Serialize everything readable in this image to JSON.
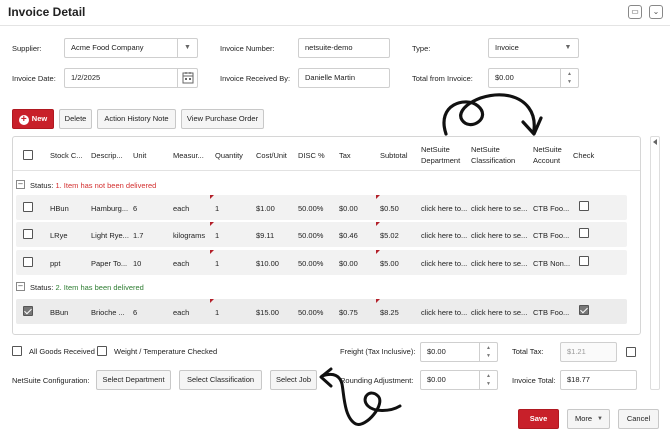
{
  "window": {
    "title": "Invoice Detail"
  },
  "form": {
    "supplier_label": "Supplier:",
    "supplier_value": "Acme Food Company",
    "invoice_number_label": "Invoice Number:",
    "invoice_number_value": "netsuite-demo",
    "type_label": "Type:",
    "type_value": "Invoice",
    "invoice_date_label": "Invoice Date:",
    "invoice_date_value": "1/2/2025",
    "received_by_label": "Invoice Received By:",
    "received_by_value": "Danielle Martin",
    "total_from_invoice_label": "Total from Invoice:",
    "total_from_invoice_value": "$0.00"
  },
  "toolbar": {
    "new_label": "New",
    "delete_label": "Delete",
    "history_label": "Action History Note",
    "view_po_label": "View Purchase Order"
  },
  "table": {
    "headers": {
      "stock_code": "Stock C...",
      "description": "Descrip...",
      "unit": "Unit",
      "measure": "Measur...",
      "quantity": "Quantity",
      "cost_unit": "Cost/Unit",
      "disc": "DISC %",
      "tax": "Tax",
      "subtotal": "Subtotal",
      "ns_department": "NetSuite\nDepartment",
      "ns_classification": "NetSuite\nClassification",
      "ns_account": "NetSuite\nAccount",
      "check": "Check"
    },
    "groups": [
      {
        "status_prefix": "Status: ",
        "status_text": "1. Item has not been delivered",
        "status_color": "#d32f2f",
        "rows": [
          {
            "code": "HBun",
            "desc": "Hamburg...",
            "unit": "6",
            "measure": "each",
            "qty": "1",
            "cost": "$1.00",
            "disc": "50.00%",
            "tax": "$0.00",
            "subtotal": "$0.50",
            "dept": "click here to...",
            "cls": "click here to se...",
            "account": "CTB Foo...",
            "checked": false
          },
          {
            "code": "LRye",
            "desc": "Light Rye...",
            "unit": "1.7",
            "measure": "kilograms",
            "qty": "1",
            "cost": "$9.11",
            "disc": "50.00%",
            "tax": "$0.46",
            "subtotal": "$5.02",
            "dept": "click here to...",
            "cls": "click here to se...",
            "account": "CTB Foo...",
            "checked": false
          },
          {
            "code": "ppt",
            "desc": "Paper To...",
            "unit": "10",
            "measure": "each",
            "qty": "1",
            "cost": "$10.00",
            "disc": "50.00%",
            "tax": "$0.00",
            "subtotal": "$5.00",
            "dept": "click here to...",
            "cls": "click here to se...",
            "account": "CTB Non...",
            "checked": false
          }
        ]
      },
      {
        "status_prefix": "Status: ",
        "status_text": "2. Item has been delivered",
        "status_color": "#2e7d32",
        "rows": [
          {
            "code": "BBun",
            "desc": "Brioche ...",
            "unit": "6",
            "measure": "each",
            "qty": "1",
            "cost": "$15.00",
            "disc": "50.00%",
            "tax": "$0.75",
            "subtotal": "$8.25",
            "dept": "click here to...",
            "cls": "click here to se...",
            "account": "CTB Foo...",
            "checked": true
          }
        ]
      }
    ]
  },
  "footer": {
    "all_goods_label": "All Goods Received",
    "weight_label": "Weight / Temperature Checked",
    "freight_label": "Freight (Tax Inclusive):",
    "freight_value": "$0.00",
    "total_tax_label": "Total Tax:",
    "total_tax_value": "$1.21",
    "netsuite_config_label": "NetSuite Configuration:",
    "select_department_label": "Select Department",
    "select_classification_label": "Select Classification",
    "select_job_label": "Select Job",
    "rounding_label": "Rounding Adjustment:",
    "rounding_value": "$0.00",
    "invoice_total_label": "Invoice Total:",
    "invoice_total_value": "$18.77",
    "save_label": "Save",
    "more_label": "More",
    "cancel_label": "Cancel"
  },
  "colors": {
    "primary": "#c8202a",
    "border": "#cfcfcf",
    "row_bg": "#f2f2f2"
  },
  "icons": [
    "minimize-icon",
    "expand-icon",
    "dropdown-arrow-icon",
    "calendar-icon",
    "spinner-icon",
    "plus-icon",
    "collapse-icon",
    "check-icon",
    "scroll-left-arrow-icon",
    "curved-arrow-annotation",
    "swirl-arrow-annotation"
  ]
}
